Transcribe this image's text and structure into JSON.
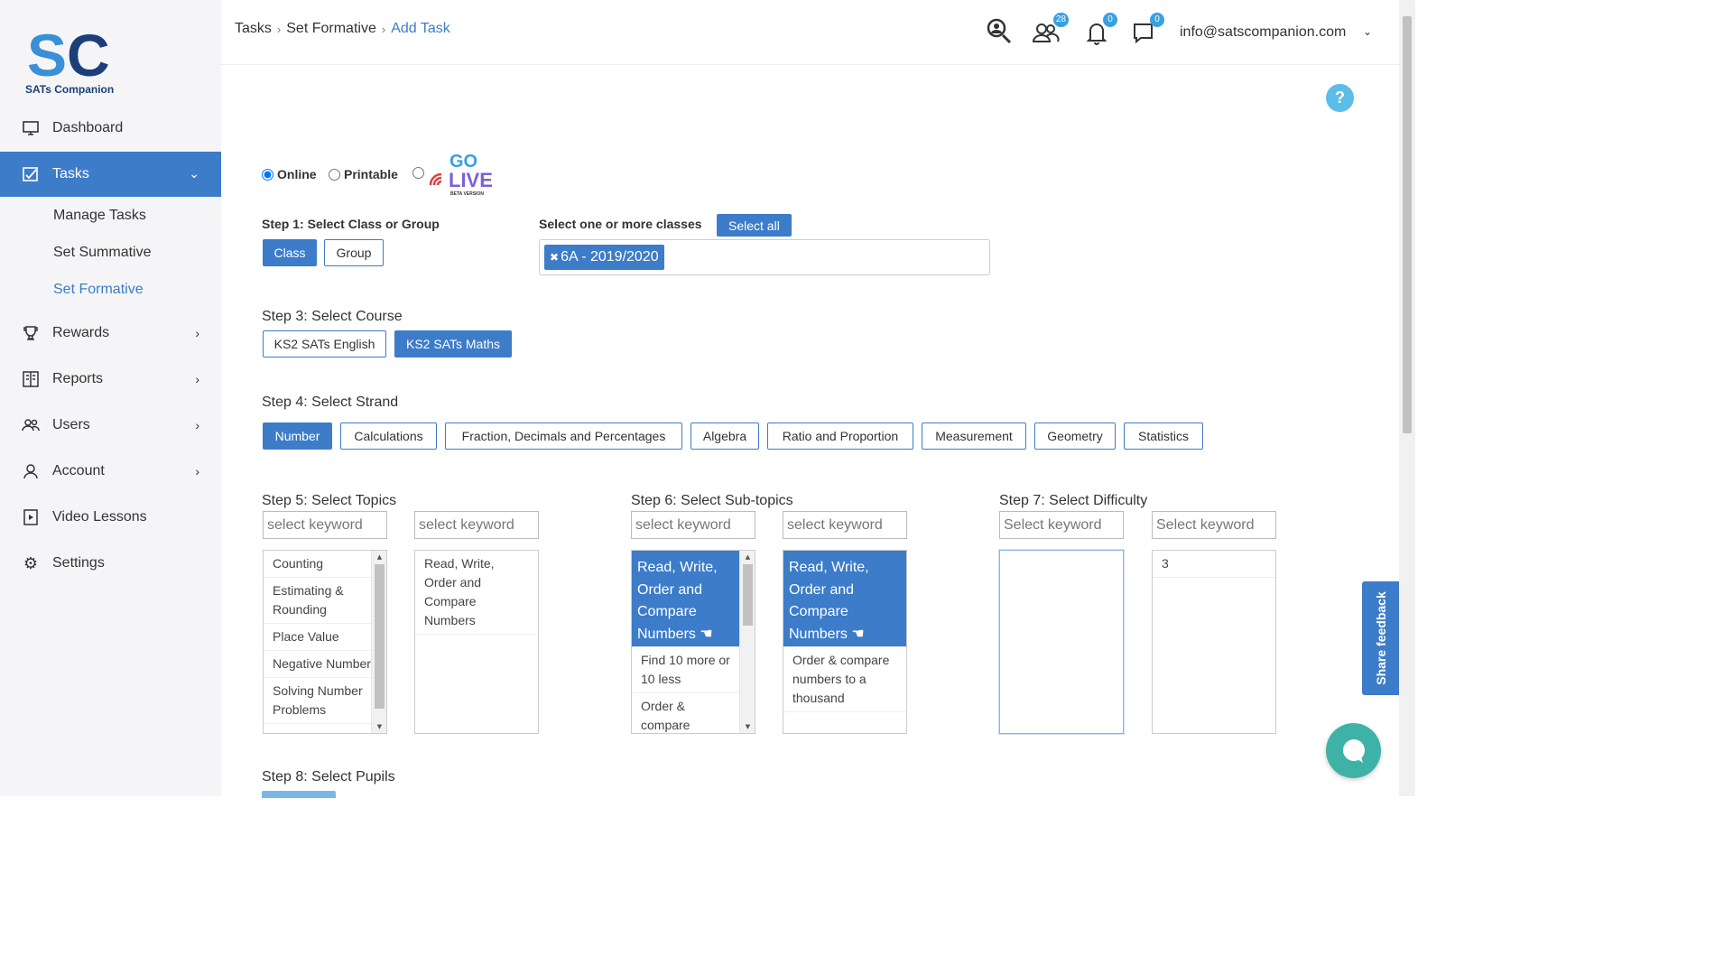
{
  "brand": {
    "name": "SATs Companion",
    "logo_letters": "SC",
    "primary_color": "#3d7cc9"
  },
  "sidebar": {
    "items": [
      {
        "label": "Dashboard",
        "icon": "monitor-icon"
      },
      {
        "label": "Tasks",
        "icon": "tasks-icon",
        "active": true
      },
      {
        "label": "Rewards",
        "icon": "trophy-icon"
      },
      {
        "label": "Reports",
        "icon": "reports-icon"
      },
      {
        "label": "Users",
        "icon": "users-icon"
      },
      {
        "label": "Account",
        "icon": "account-icon"
      },
      {
        "label": "Video Lessons",
        "icon": "video-icon"
      },
      {
        "label": "Settings",
        "icon": "gear-icon"
      }
    ],
    "tasks_sub": [
      "Manage Tasks",
      "Set Summative",
      "Set Formative"
    ]
  },
  "header": {
    "breadcrumbs": [
      "Tasks",
      "Set Formative",
      "Add Task"
    ],
    "users_badge": "28",
    "notifications_badge": "0",
    "messages_badge": "0",
    "email": "info@satscompanion.com"
  },
  "mode": {
    "online": "Online",
    "printable": "Printable",
    "golive_top": "GO",
    "golive_bottom": "LIVE",
    "golive_tag": "BETA VERSION",
    "selected": "online"
  },
  "step1": {
    "label": "Step 1: Select Class or Group",
    "class_btn": "Class",
    "group_btn": "Group"
  },
  "step2": {
    "label": "Select one or more classes",
    "select_all": "Select all",
    "chips": [
      "6A - 2019/2020"
    ]
  },
  "step3": {
    "label": "Step 3: Select Course",
    "courses": [
      "KS2 SATs English",
      "KS2 SATs Maths"
    ],
    "selected": "KS2 SATs Maths"
  },
  "step4": {
    "label": "Step 4: Select Strand",
    "strands": [
      "Number",
      "Calculations",
      "Fraction, Decimals and Percentages",
      "Algebra",
      "Ratio and Proportion",
      "Measurement",
      "Geometry",
      "Statistics"
    ],
    "selected": "Number"
  },
  "step5": {
    "label": "Step 5: Select Topics",
    "placeholder": "select keyword",
    "available": [
      "Counting",
      "Estimating & Rounding",
      "Place Value",
      "Negative Numbers",
      "Solving Number Problems"
    ],
    "selected": [
      "Read, Write, Order and Compare Numbers"
    ]
  },
  "step6": {
    "label": "Step 6: Select Sub-topics",
    "placeholder": "select keyword",
    "available_header": "Read, Write, Order and Compare Numbers",
    "available": [
      "Find 10 more or 10 less",
      "Order & compare numbers"
    ],
    "selected_header": "Read, Write, Order and Compare Numbers",
    "selected": [
      "Order & compare numbers to a thousand"
    ]
  },
  "step7": {
    "label": "Step 7: Select Difficulty",
    "placeholder": "Select keyword",
    "available": [],
    "selected": [
      "3"
    ]
  },
  "step8": {
    "label": "Step 8: Select Pupils"
  },
  "feedback": {
    "label": "Share feedback"
  },
  "help": {
    "label": "?"
  }
}
